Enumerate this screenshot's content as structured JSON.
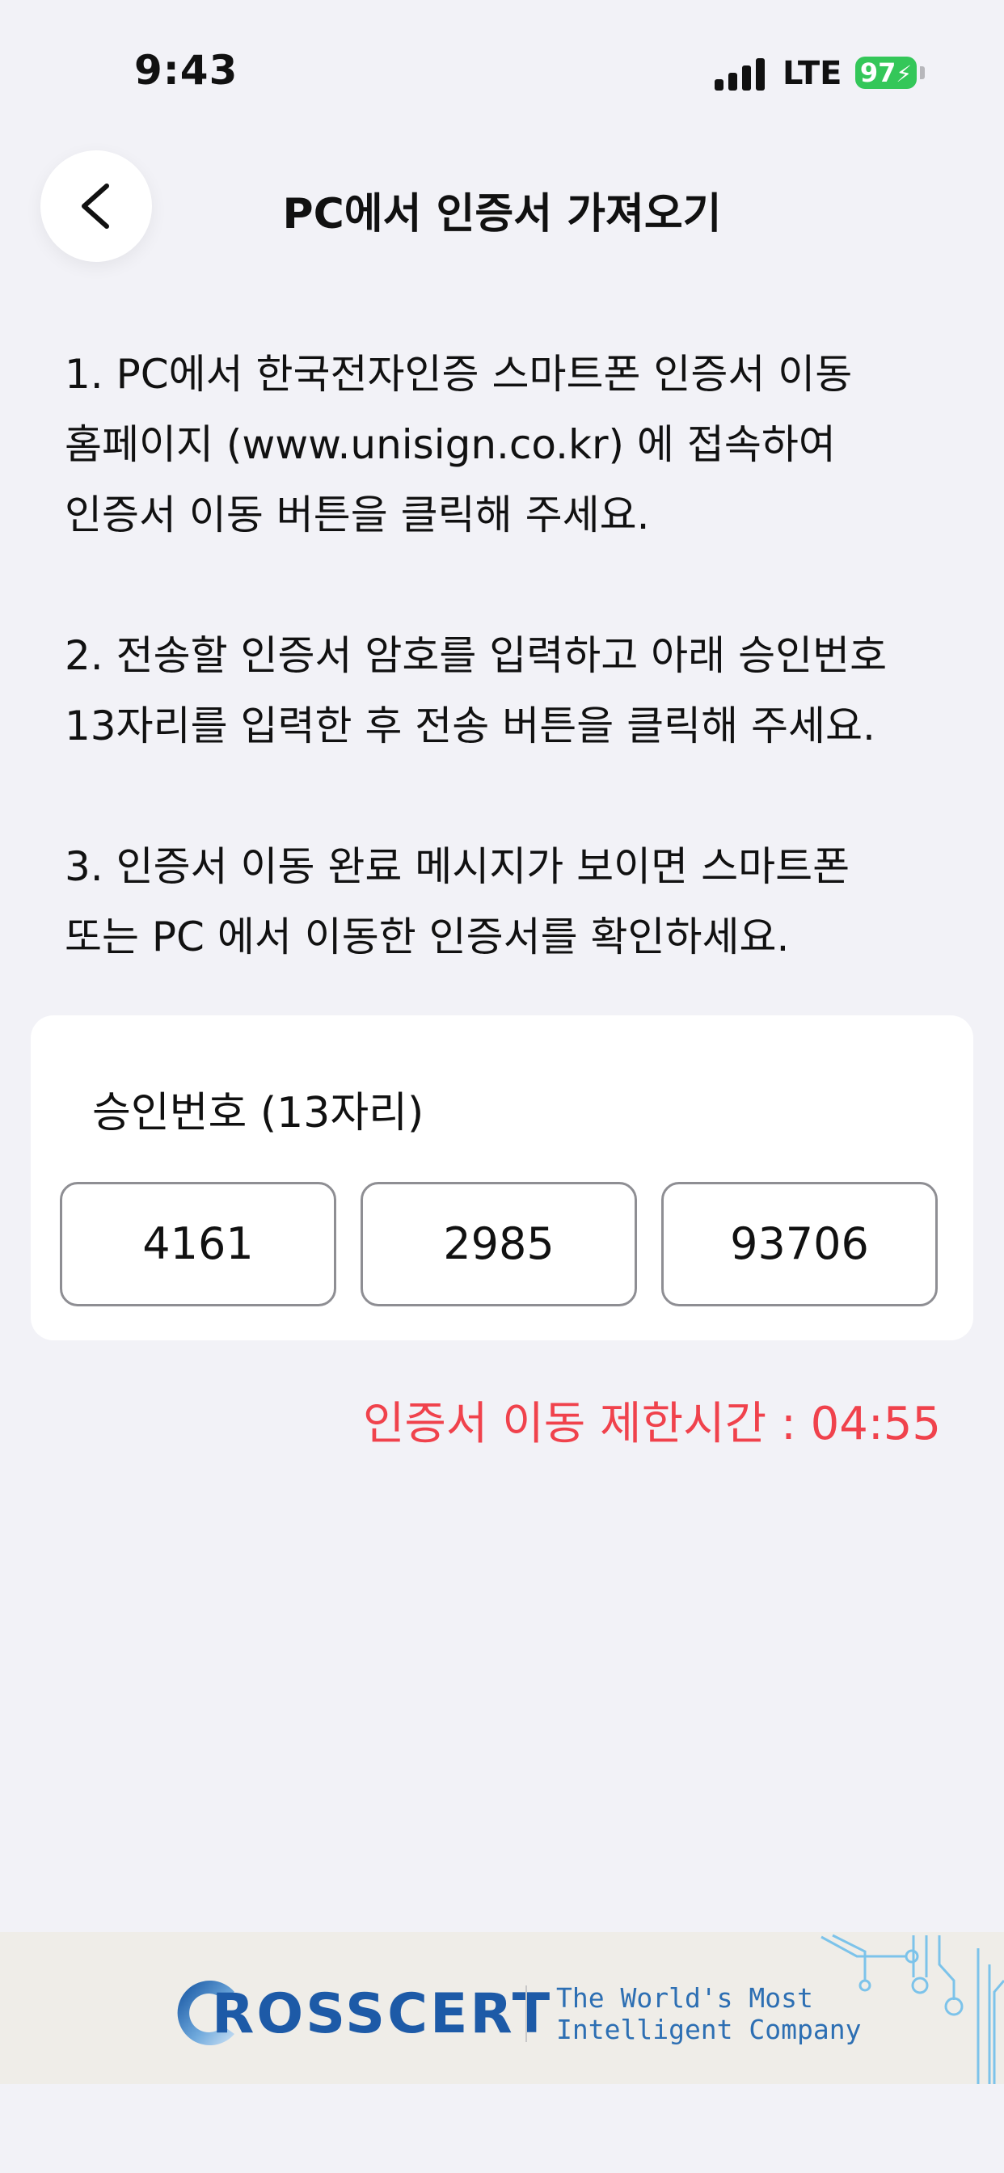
{
  "status_bar": {
    "time": "9:43",
    "network": "LTE",
    "battery": "97"
  },
  "header": {
    "title": "PC에서 인증서 가져오기",
    "back_icon": "chevron-left-icon"
  },
  "instructions": [
    "1. PC에서 한국전자인증 스마트폰 인증서 이동\n홈페이지 (www.unisign.co.kr) 에 접속하여\n인증서 이동 버튼을 클릭해 주세요.",
    "2. 전송할 인증서 암호를 입력하고 아래 승인번호\n13자리를 입력한 후 전송 버튼을 클릭해 주세요.",
    "3. 인증서 이동 완료 메시지가 보이면 스마트폰\n또는 PC 에서 이동한 인증서를 확인하세요."
  ],
  "approval": {
    "label": "승인번호 (13자리)",
    "codes": [
      "4161",
      "2985",
      "93706"
    ]
  },
  "timer": {
    "text": "인증서 이동 제한시간 : 04:55",
    "color": "#f0424c"
  },
  "footer": {
    "logo_text": "ROSSCERT",
    "slogan": "The World's Most\nIntelligent Company",
    "brand_color": "#1d5aa7"
  }
}
